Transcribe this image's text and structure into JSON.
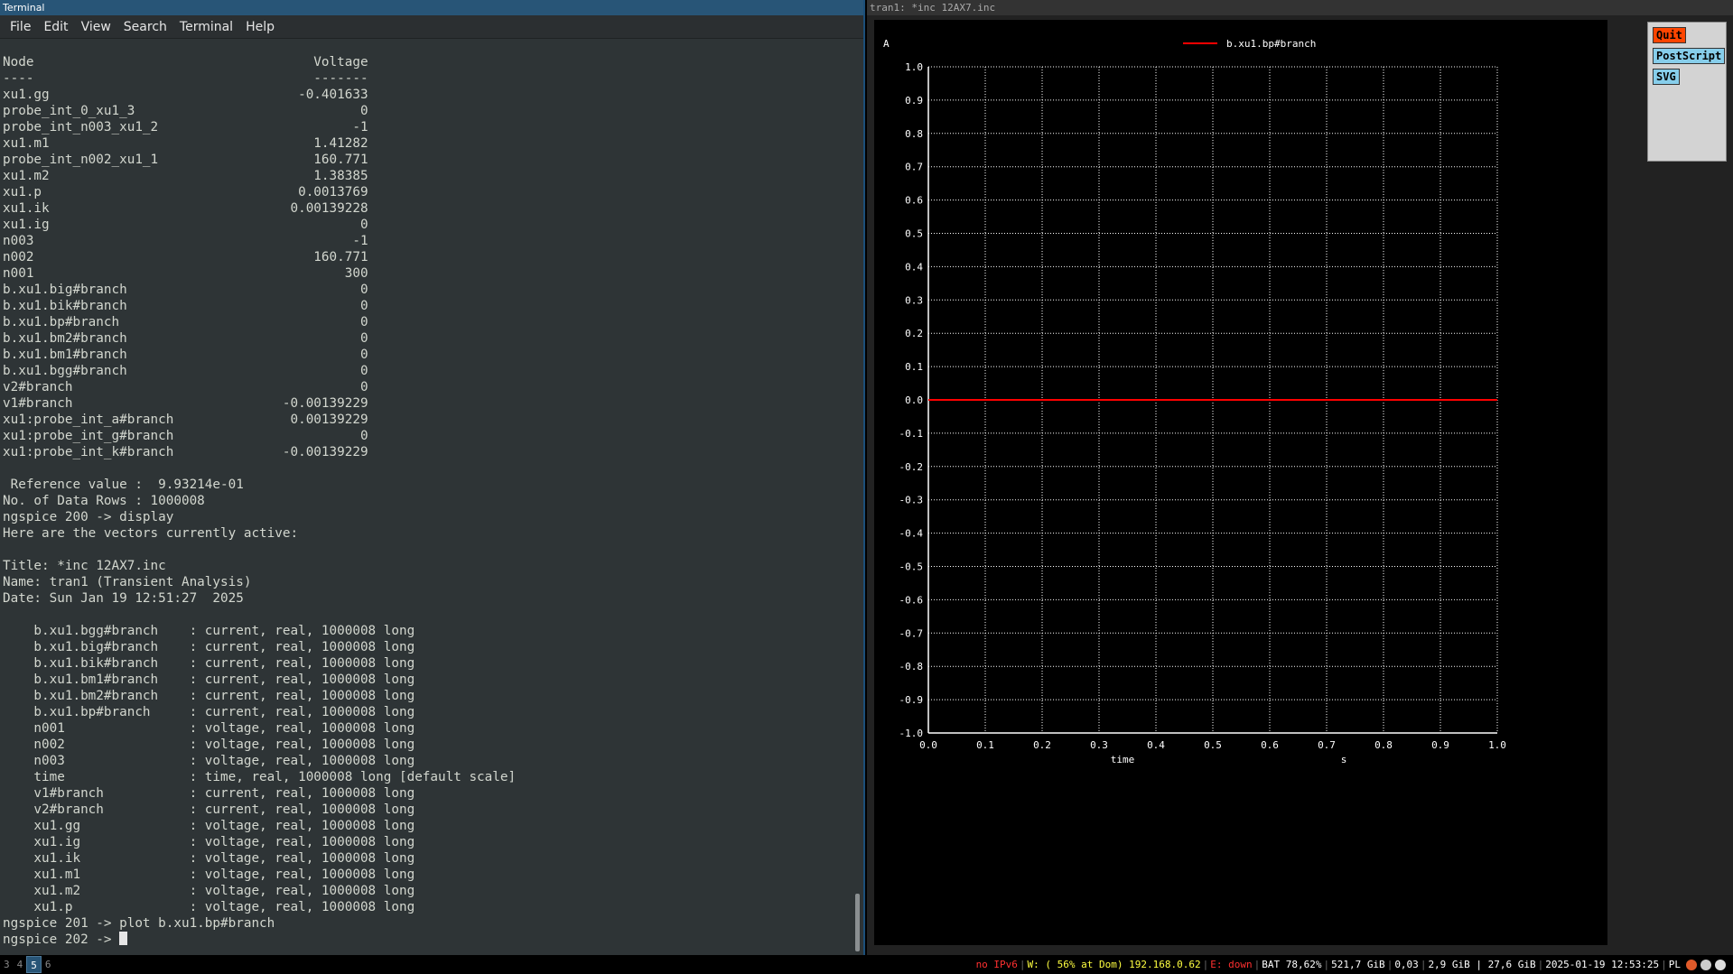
{
  "terminal": {
    "title": "Terminal",
    "menu": [
      "File",
      "Edit",
      "View",
      "Search",
      "Terminal",
      "Help"
    ],
    "lines": [
      "Node                                    Voltage",
      "----                                    -------",
      "xu1.gg                                -0.401633",
      "probe_int_0_xu1_3                             0",
      "probe_int_n003_xu1_2                         -1",
      "xu1.m1                                  1.41282",
      "probe_int_n002_xu1_1                    160.771",
      "xu1.m2                                  1.38385",
      "xu1.p                                 0.0013769",
      "xu1.ik                               0.00139228",
      "xu1.ig                                        0",
      "n003                                         -1",
      "n002                                    160.771",
      "n001                                        300",
      "b.xu1.big#branch                              0",
      "b.xu1.bik#branch                              0",
      "b.xu1.bp#branch                               0",
      "b.xu1.bm2#branch                              0",
      "b.xu1.bm1#branch                              0",
      "b.xu1.bgg#branch                              0",
      "v2#branch                                     0",
      "v1#branch                           -0.00139229",
      "xu1:probe_int_a#branch               0.00139229",
      "xu1:probe_int_g#branch                        0",
      "xu1:probe_int_k#branch              -0.00139229",
      "",
      " Reference value :  9.93214e-01",
      "No. of Data Rows : 1000008",
      "ngspice 200 -> display",
      "Here are the vectors currently active:",
      "",
      "Title: *inc 12AX7.inc",
      "Name: tran1 (Transient Analysis)",
      "Date: Sun Jan 19 12:51:27  2025",
      "",
      "    b.xu1.bgg#branch    : current, real, 1000008 long",
      "    b.xu1.big#branch    : current, real, 1000008 long",
      "    b.xu1.bik#branch    : current, real, 1000008 long",
      "    b.xu1.bm1#branch    : current, real, 1000008 long",
      "    b.xu1.bm2#branch    : current, real, 1000008 long",
      "    b.xu1.bp#branch     : current, real, 1000008 long",
      "    n001                : voltage, real, 1000008 long",
      "    n002                : voltage, real, 1000008 long",
      "    n003                : voltage, real, 1000008 long",
      "    time                : time, real, 1000008 long [default scale]",
      "    v1#branch           : current, real, 1000008 long",
      "    v2#branch           : current, real, 1000008 long",
      "    xu1.gg              : voltage, real, 1000008 long",
      "    xu1.ig              : voltage, real, 1000008 long",
      "    xu1.ik              : voltage, real, 1000008 long",
      "    xu1.m1              : voltage, real, 1000008 long",
      "    xu1.m2              : voltage, real, 1000008 long",
      "    xu1.p               : voltage, real, 1000008 long",
      "ngspice 201 -> plot b.xu1.bp#branch"
    ],
    "prompt": "ngspice 202 -> "
  },
  "plot_window": {
    "title": "tran1: *inc 12AX7.inc",
    "buttons": {
      "quit": "Quit",
      "postscript": "PostScript",
      "svg": "SVG"
    }
  },
  "chart_data": {
    "type": "line",
    "title": "",
    "ylabel": "A",
    "xlabel": "time",
    "xunit": "s",
    "xlim": [
      0.0,
      1.0
    ],
    "ylim": [
      -1.0,
      1.0
    ],
    "xticks": [
      "0.0",
      "0.1",
      "0.2",
      "0.3",
      "0.4",
      "0.5",
      "0.6",
      "0.7",
      "0.8",
      "0.9",
      "1.0"
    ],
    "yticks": [
      "1.0",
      "0.9",
      "0.8",
      "0.7",
      "0.6",
      "0.5",
      "0.4",
      "0.3",
      "0.2",
      "0.1",
      "0.0",
      "-0.1",
      "-0.2",
      "-0.3",
      "-0.4",
      "-0.5",
      "-0.6",
      "-0.7",
      "-0.8",
      "-0.9",
      "-1.0"
    ],
    "grid": true,
    "legend": "top",
    "series": [
      {
        "name": "b.xu1.bp#branch",
        "color": "#ff0000",
        "x": [
          0.0,
          1.0
        ],
        "y": [
          0.0,
          0.0
        ]
      }
    ]
  },
  "statusbar": {
    "workspaces": [
      "3",
      "4",
      "5",
      "6"
    ],
    "active_workspace": "5",
    "ipv6": "no IPv6",
    "wifi": "W: ( 56% at Dom) 192.168.0.62",
    "ethernet": "E: down",
    "battery": "BAT 78,62%",
    "disk": "521,7 GiB",
    "load": "0,03",
    "mem": "2,9 GiB | 27,6 GiB",
    "datetime": "2025-01-19 12:53:25",
    "lang": "PL"
  }
}
